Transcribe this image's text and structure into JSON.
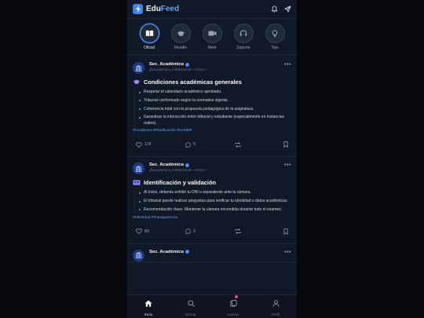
{
  "app": {
    "brand_part1": "Edu",
    "brand_part2": "Feed",
    "accent": "#3b82f6"
  },
  "stories": [
    {
      "label": "Oficial",
      "icon": "book-icon",
      "active": true
    },
    {
      "label": "Moodle",
      "icon": "graduation-cap-icon",
      "active": false
    },
    {
      "label": "Meet",
      "icon": "video-icon",
      "active": false
    },
    {
      "label": "Soporte",
      "icon": "headset-icon",
      "active": false
    },
    {
      "label": "Tips",
      "icon": "lightbulb-icon",
      "active": false
    }
  ],
  "posts": [
    {
      "author": "Sec. Académica",
      "handle": "@academica_institucional • Anexo I",
      "title": "Condiciones académicas generales",
      "title_icon": "graduation-cap-icon",
      "bullets": [
        "Respetar el calendario académico aprobado.",
        "Tribunal conformado según la normativa vigente.",
        "Coherencia total con la propuesta pedagógica de la asignatura.",
        "Garantizar la interacción entre tribunal y estudiante (especialmente en instancias orales)."
      ],
      "tags": "#Academia #Planificación #UADER",
      "likes": "124",
      "comments": "5"
    },
    {
      "author": "Sec. Académica",
      "handle": "@academica_institucional • Anexo I",
      "title": "Identificación y validación",
      "title_icon": "id-card-icon",
      "bullets": [
        "Al inicio, deberás exhibir tu DNI o equivalente ante la cámara.",
        "El tribunal puede realizar preguntas para verificar tu identidad o datos académicos.",
        "Recomendación clave: Mantener la cámara encendida durante todo el examen."
      ],
      "tags": "#Identidad #Transparencia",
      "likes": "89",
      "comments": "2"
    },
    {
      "author": "Sec. Académica"
    }
  ],
  "nav": [
    {
      "label": "Inicio",
      "icon": "home-icon",
      "active": true
    },
    {
      "label": "Buscar",
      "icon": "search-icon",
      "active": false
    },
    {
      "label": "Anexos",
      "icon": "documents-icon",
      "active": false
    },
    {
      "label": "Perfil",
      "icon": "user-icon",
      "active": false
    }
  ]
}
